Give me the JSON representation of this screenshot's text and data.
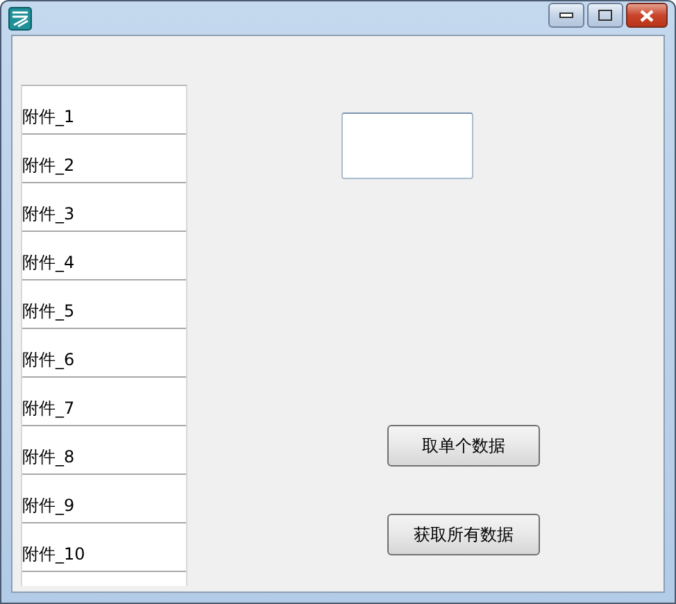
{
  "attachments": [
    {
      "label": "附件_1"
    },
    {
      "label": "附件_2"
    },
    {
      "label": "附件_3"
    },
    {
      "label": "附件_4"
    },
    {
      "label": "附件_5"
    },
    {
      "label": "附件_6"
    },
    {
      "label": "附件_7"
    },
    {
      "label": "附件_8"
    },
    {
      "label": "附件_9"
    },
    {
      "label": "附件_10"
    }
  ],
  "buttons": [
    {
      "label": "取单个数据"
    },
    {
      "label": "获取所有数据"
    }
  ]
}
